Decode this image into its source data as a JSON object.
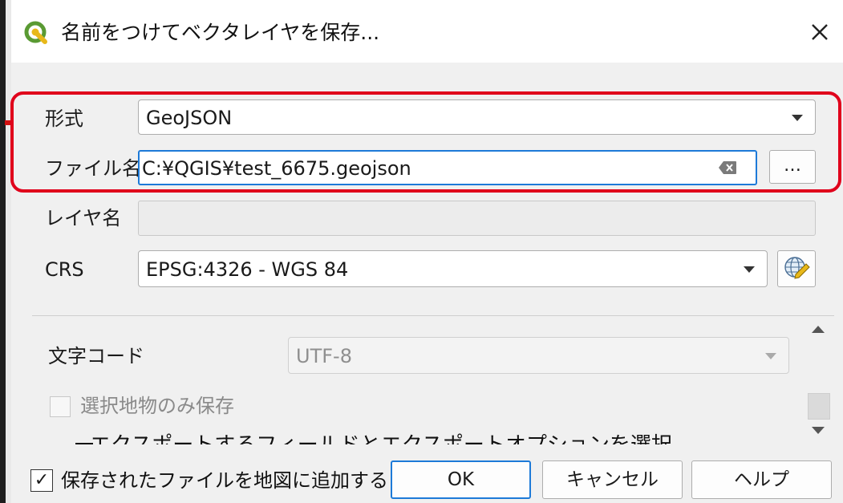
{
  "dialog": {
    "title": "名前をつけてベクタレイヤを保存...",
    "close_icon": "close-icon",
    "app_icon": "qgis-logo-icon"
  },
  "form": {
    "format": {
      "label": "形式",
      "value": "GeoJSON"
    },
    "filename": {
      "label": "ファイル名",
      "value": "C:¥QGIS¥test_6675.geojson",
      "browse_label": "…"
    },
    "layer_name": {
      "label": "レイヤ名",
      "value": ""
    },
    "crs": {
      "label": "CRS",
      "value": "EPSG:4326 - WGS 84",
      "select_icon": "globe-crs-icon"
    },
    "encoding": {
      "label": "文字コード",
      "value": "UTF-8"
    },
    "selected_only": {
      "label": "選択地物のみ保存",
      "checked": false
    },
    "export_fields_label": "エクスポートするフィールドとエクスポートオプションを選択"
  },
  "footer": {
    "add_to_map": {
      "label": "保存されたファイルを地図に追加する",
      "checked": true,
      "check_glyph": "✓"
    },
    "ok_label": "OK",
    "cancel_label": "キャンセル",
    "help_label": "ヘルプ"
  },
  "colors": {
    "highlight": "#e0001b",
    "focus_border": "#1d7ad8",
    "dialog_bg": "#f0f0f0"
  }
}
